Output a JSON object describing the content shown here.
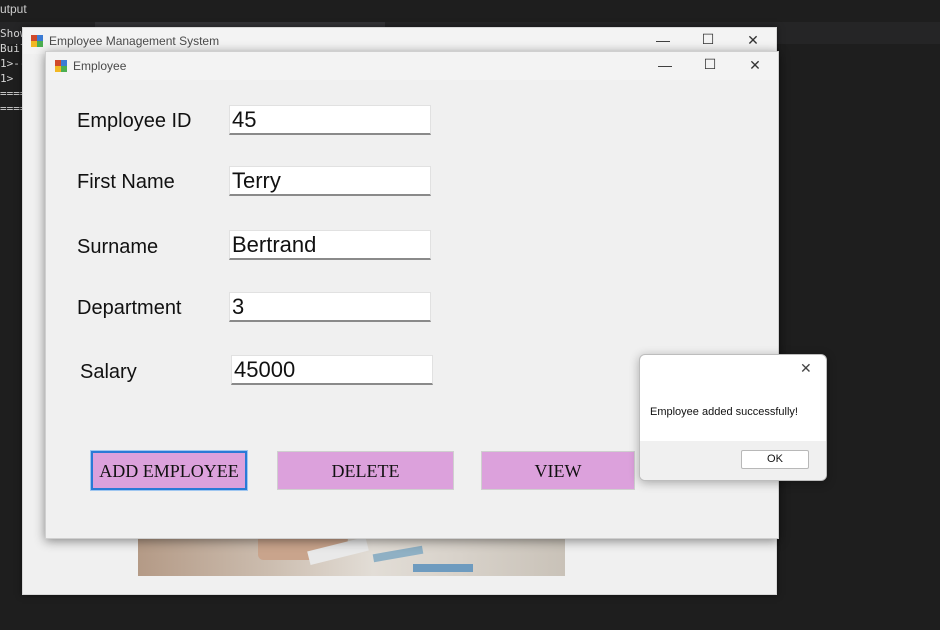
{
  "ide": {
    "panel_title": "utput",
    "lines": [
      "Show",
      "Buil",
      "1>--",
      "1>",
      "====",
      "===="
    ]
  },
  "parent_window": {
    "title": "Employee Management System",
    "controls": {
      "minimize": "—",
      "maximize": "☐",
      "close": "✕"
    }
  },
  "employee_window": {
    "title": "Employee",
    "controls": {
      "minimize": "—",
      "maximize": "☐",
      "close": "✕"
    },
    "fields": [
      {
        "label": "Employee ID",
        "value": "45"
      },
      {
        "label": "First Name",
        "value": "Terry"
      },
      {
        "label": "Surname",
        "value": "Bertrand"
      },
      {
        "label": "Department",
        "value": "3"
      },
      {
        "label": "Salary",
        "value": "45000"
      }
    ],
    "buttons": {
      "add": "ADD EMPLOYEE",
      "delete": "DELETE",
      "view": "VIEW"
    },
    "button_color": "#dca1dc"
  },
  "message_box": {
    "text": "Employee added successfully!",
    "ok_label": "OK",
    "close": "✕"
  }
}
